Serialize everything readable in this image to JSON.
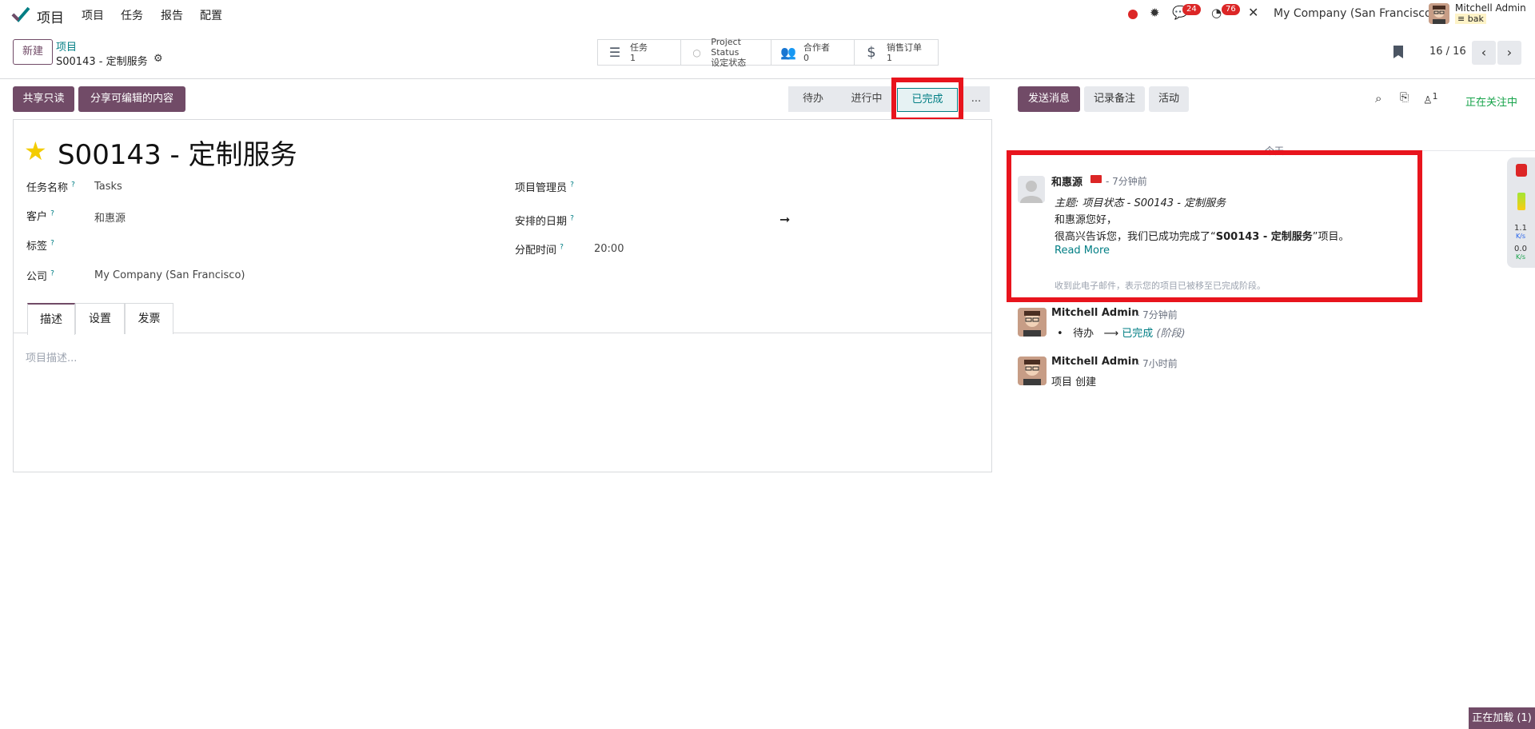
{
  "topbar": {
    "app_name": "项目",
    "menu": [
      "项目",
      "任务",
      "报告",
      "配置"
    ],
    "messages_count": "24",
    "activities_count": "76",
    "company": "My Company (San Francisco)",
    "user_name": "Mitchell Admin",
    "user_db": "bak"
  },
  "control": {
    "new_label": "新建",
    "breadcrumb_parent": "项目",
    "breadcrumb_current": "S00143 - 定制服务",
    "pager": "16 / 16"
  },
  "smart_buttons": [
    {
      "label": "任务",
      "value": "1",
      "icon": "tasks-icon"
    },
    {
      "label": "Project Status",
      "value": "设定状态",
      "icon": "status-dot-icon"
    },
    {
      "label": "合作者",
      "value": "0",
      "icon": "users-icon"
    },
    {
      "label": "销售订单",
      "value": "1",
      "icon": "dollar-icon"
    }
  ],
  "actions": {
    "share_readonly": "共享只读",
    "share_editable": "分享可编辑的内容"
  },
  "stages": [
    "待办",
    "进行中",
    "已完成"
  ],
  "stages_more": "...",
  "form": {
    "title": "S00143 - 定制服务",
    "task_name_label": "任务名称",
    "task_name_value": "Tasks",
    "customer_label": "客户",
    "customer_value": "和惠源",
    "tags_label": "标签",
    "company_label": "公司",
    "company_value": "My Company (San Francisco)",
    "manager_label": "项目管理员",
    "planned_date_label": "安排的日期",
    "arrow": "➞",
    "allocated_label": "分配时间",
    "allocated_value": "20:00",
    "help_mark": "?",
    "tabs": [
      "描述",
      "设置",
      "发票"
    ],
    "description_placeholder": "项目描述..."
  },
  "chatter": {
    "send_message": "发送消息",
    "log_note": "记录备注",
    "activity": "活动",
    "followers_count": "1",
    "following": "正在关注中",
    "today": "今天",
    "messages": [
      {
        "author": "和惠源",
        "time": "- 7分钟前",
        "subject": "主题: 项目状态 - S00143 - 定制服务",
        "line1": "和惠源您好，",
        "line2_pre": "很高兴告诉您，我们已成功完成了“",
        "line2_bold": "S00143 - 定制服务",
        "line2_post": "”项目。",
        "read_more": "Read More",
        "footer": "收到此电子邮件，表示您的项目已被移至已完成阶段。"
      },
      {
        "author": "Mitchell Admin",
        "time": "- 7分钟前",
        "from": "待办",
        "to": "已完成",
        "field": "(阶段)"
      },
      {
        "author": "Mitchell Admin",
        "time": "- 7小时前",
        "text": "项目 创建"
      }
    ]
  },
  "side_gadget": {
    "v1": "1.1",
    "u1": "K/s",
    "v2": "0.0",
    "u2": "K/s"
  },
  "loading": "正在加载 (1)",
  "colors": {
    "brand": "#714b67",
    "accent": "#017e84",
    "highlight": "#e8141d"
  }
}
